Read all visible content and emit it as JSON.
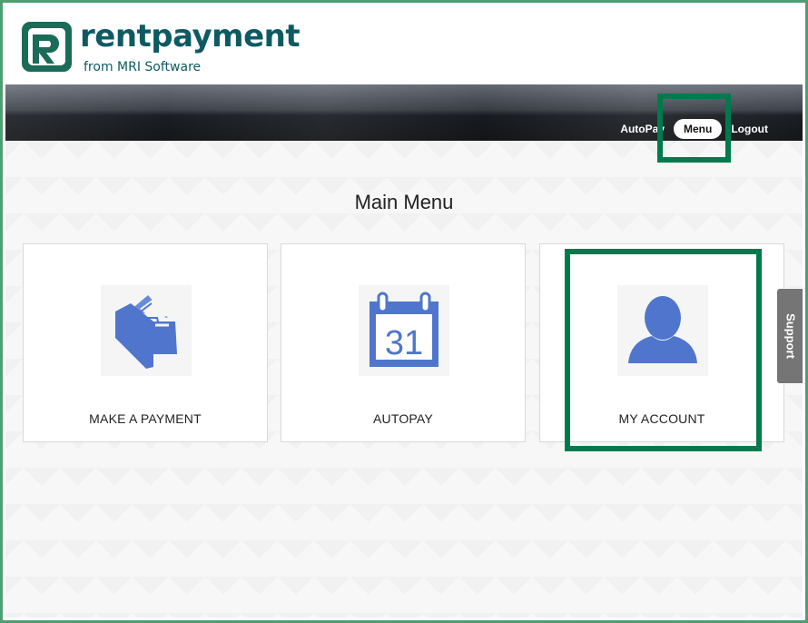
{
  "brand": {
    "name": "rentpayment",
    "sub": "from MRI Software",
    "color": "#0e5a63",
    "mark_color": "#1a6b58"
  },
  "nav": {
    "items": [
      {
        "label": "AutoPay",
        "active": false
      },
      {
        "label": "Menu",
        "active": true
      },
      {
        "label": "Logout",
        "active": false
      }
    ]
  },
  "main": {
    "title": "Main Menu",
    "cards": [
      {
        "label": "MAKE A PAYMENT",
        "icon": "wallet-icon"
      },
      {
        "label": "AUTOPAY",
        "icon": "calendar-icon",
        "icon_text": "31"
      },
      {
        "label": "MY ACCOUNT",
        "icon": "user-icon"
      }
    ]
  },
  "support": {
    "label": "Support"
  },
  "colors": {
    "icon_blue": "#4f76cc",
    "highlight_green": "#007a4d",
    "page_border": "#4e9e72"
  }
}
